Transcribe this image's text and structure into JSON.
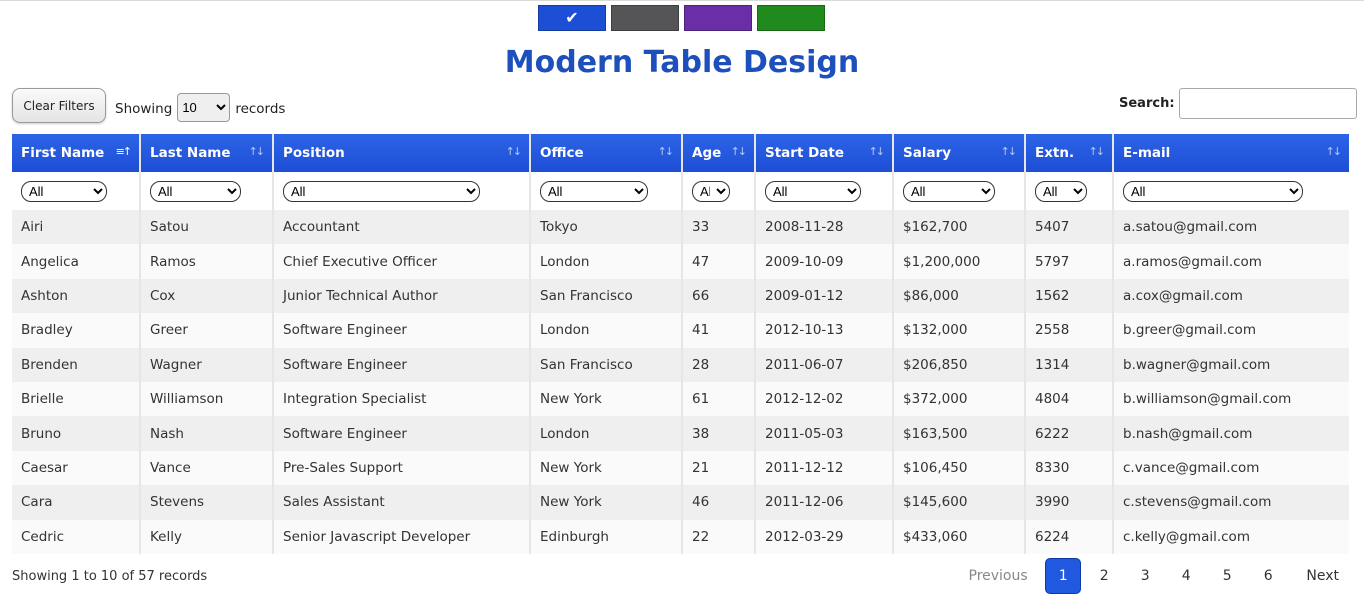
{
  "theme": {
    "swatches": [
      {
        "name": "blue",
        "color": "#1d4ed6",
        "selected": true,
        "icon": "check-icon"
      },
      {
        "name": "gray",
        "color": "#555558",
        "selected": false
      },
      {
        "name": "purple",
        "color": "#6a2ea6",
        "selected": false
      },
      {
        "name": "green",
        "color": "#218a1e",
        "selected": false
      }
    ]
  },
  "title": "Modern Table Design",
  "toolbar": {
    "clear_label": "Clear Filters",
    "showing_label": "Showing",
    "records_label": "records",
    "page_size": "10",
    "search_label": "Search:",
    "search_value": ""
  },
  "columns": [
    {
      "label": "First Name",
      "filter": "All",
      "sorted": true
    },
    {
      "label": "Last Name",
      "filter": "All",
      "sorted": false
    },
    {
      "label": "Position",
      "filter": "All",
      "sorted": false
    },
    {
      "label": "Office",
      "filter": "All",
      "sorted": false
    },
    {
      "label": "Age",
      "filter": "All",
      "sorted": false
    },
    {
      "label": "Start Date",
      "filter": "All",
      "sorted": false
    },
    {
      "label": "Salary",
      "filter": "All",
      "sorted": false
    },
    {
      "label": "Extn.",
      "filter": "All",
      "sorted": false
    },
    {
      "label": "E-mail",
      "filter": "All",
      "sorted": false
    }
  ],
  "rows": [
    [
      "Airi",
      "Satou",
      "Accountant",
      "Tokyo",
      "33",
      "2008-11-28",
      "$162,700",
      "5407",
      "a.satou@gmail.com"
    ],
    [
      "Angelica",
      "Ramos",
      "Chief Executive Officer",
      "London",
      "47",
      "2009-10-09",
      "$1,200,000",
      "5797",
      "a.ramos@gmail.com"
    ],
    [
      "Ashton",
      "Cox",
      "Junior Technical Author",
      "San Francisco",
      "66",
      "2009-01-12",
      "$86,000",
      "1562",
      "a.cox@gmail.com"
    ],
    [
      "Bradley",
      "Greer",
      "Software Engineer",
      "London",
      "41",
      "2012-10-13",
      "$132,000",
      "2558",
      "b.greer@gmail.com"
    ],
    [
      "Brenden",
      "Wagner",
      "Software Engineer",
      "San Francisco",
      "28",
      "2011-06-07",
      "$206,850",
      "1314",
      "b.wagner@gmail.com"
    ],
    [
      "Brielle",
      "Williamson",
      "Integration Specialist",
      "New York",
      "61",
      "2012-12-02",
      "$372,000",
      "4804",
      "b.williamson@gmail.com"
    ],
    [
      "Bruno",
      "Nash",
      "Software Engineer",
      "London",
      "38",
      "2011-05-03",
      "$163,500",
      "6222",
      "b.nash@gmail.com"
    ],
    [
      "Caesar",
      "Vance",
      "Pre-Sales Support",
      "New York",
      "21",
      "2011-12-12",
      "$106,450",
      "8330",
      "c.vance@gmail.com"
    ],
    [
      "Cara",
      "Stevens",
      "Sales Assistant",
      "New York",
      "46",
      "2011-12-06",
      "$145,600",
      "3990",
      "c.stevens@gmail.com"
    ],
    [
      "Cedric",
      "Kelly",
      "Senior Javascript Developer",
      "Edinburgh",
      "22",
      "2012-03-29",
      "$433,060",
      "6224",
      "c.kelly@gmail.com"
    ]
  ],
  "footer": {
    "info": "Showing 1 to 10 of 57 records",
    "previous_label": "Previous",
    "next_label": "Next",
    "pages": [
      "1",
      "2",
      "3",
      "4",
      "5",
      "6"
    ],
    "current_page": "1"
  }
}
